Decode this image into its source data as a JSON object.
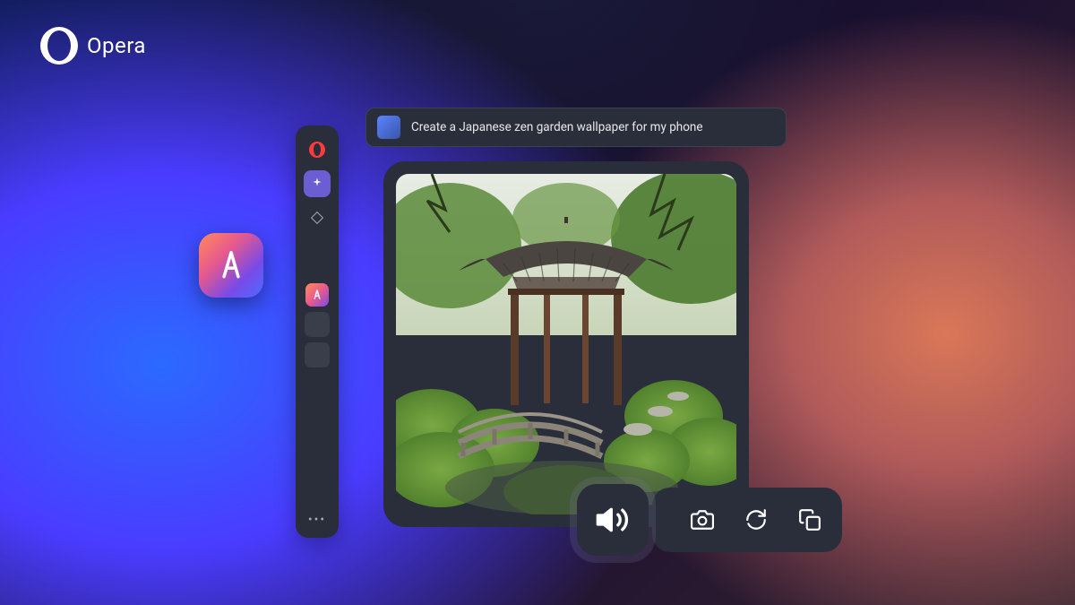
{
  "brand": {
    "name": "Opera"
  },
  "prompt": {
    "text": "Create a Japanese zen garden  wallpaper for my phone"
  },
  "sidebar": {
    "items": [
      {
        "name": "opera",
        "icon": "opera-icon"
      },
      {
        "name": "sparkle",
        "icon": "sparkle-icon"
      },
      {
        "name": "diamond",
        "icon": "diamond-icon"
      },
      {
        "name": "aria",
        "icon": "aria-icon"
      },
      {
        "name": "tab1",
        "icon": "tab"
      },
      {
        "name": "tab2",
        "icon": "tab"
      }
    ],
    "more": "•••"
  },
  "actions": {
    "primary": "speaker-icon",
    "items": [
      "camera-icon",
      "refresh-icon",
      "copy-icon"
    ]
  },
  "generated_image": {
    "description": "Japanese zen garden with pagoda pavilion, moss, stone bridge and trees"
  }
}
